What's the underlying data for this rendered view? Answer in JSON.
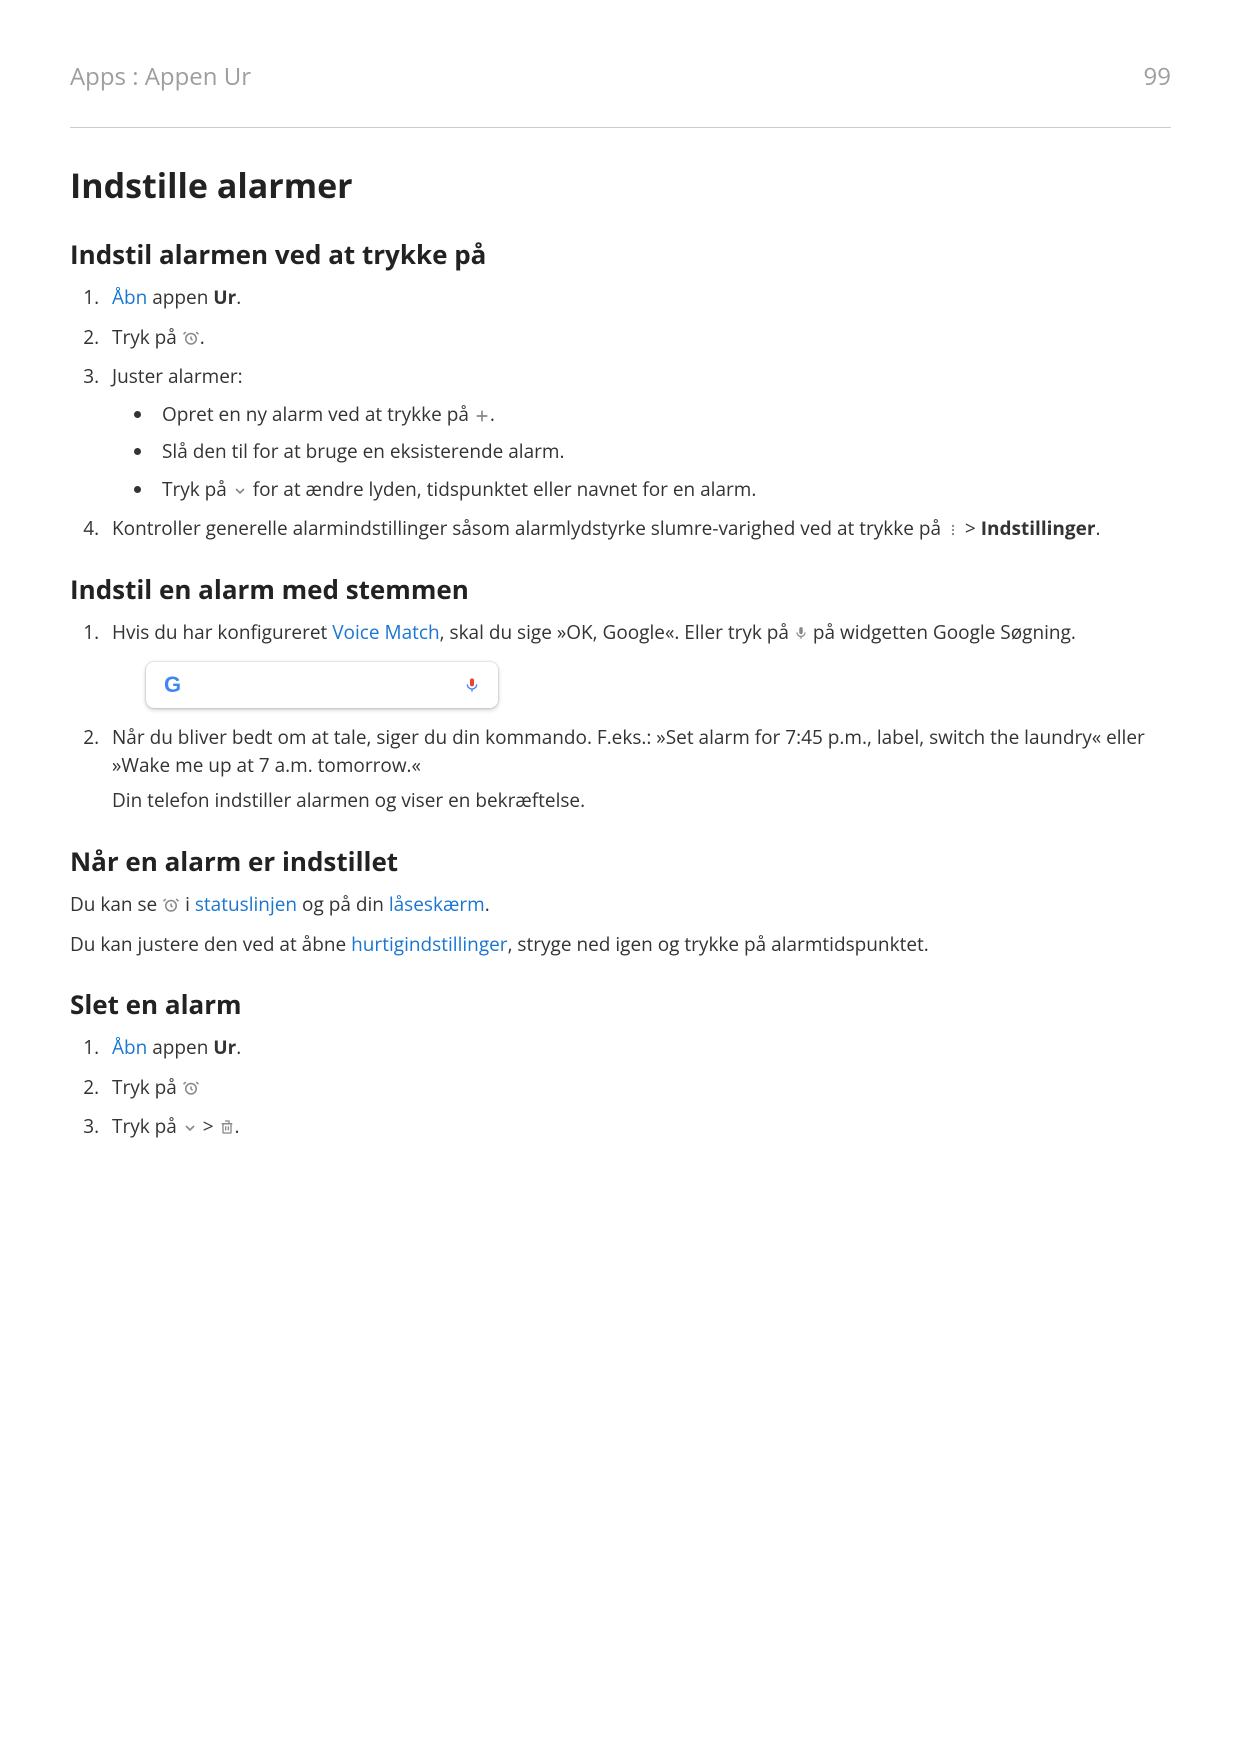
{
  "header": {
    "breadcrumb": "Apps : Appen Ur",
    "page_number": "99"
  },
  "h1": "Indstille alarmer",
  "s1": {
    "heading": "Indstil alarmen ved at trykke på",
    "li1_link": "Åbn",
    "li1_a": " appen ",
    "li1_b": "Ur",
    "li1_c": ".",
    "li2_a": "Tryk på ",
    "li2_b": ".",
    "li3": "Juster alarmer:",
    "sub1_a": "Opret en ny alarm ved at trykke på ",
    "sub1_b": ".",
    "sub2": "Slå den til for at bruge en eksisterende alarm.",
    "sub3_a": "Tryk på ",
    "sub3_b": " for at ændre lyden, tidspunktet eller navnet for en alarm.",
    "li4_a": "Kontroller generelle alarmindstillinger såsom alarmlydstyrke slumre-varighed ved at trykke på ",
    "li4_b": " > ",
    "li4_c": "Indstillinger",
    "li4_d": "."
  },
  "s2": {
    "heading": "Indstil en alarm med stemmen",
    "li1_a": "Hvis du har konfigureret ",
    "li1_link": "Voice Match",
    "li1_b": ", skal du sige »OK, Google«. Eller tryk på ",
    "li1_c": " på widgetten Google Søgning.",
    "li2": "Når du bliver bedt om at tale, siger du din kommando. F.eks.: »Set alarm for 7:45 p.m., label, switch the laundry« eller »Wake me up at 7 a.m. tomorrow.«",
    "li2_after": "Din telefon indstiller alarmen og viser en bekræftelse."
  },
  "s3": {
    "heading": "Når en alarm er indstillet",
    "p1_a": "Du kan se ",
    "p1_b": " i ",
    "p1_link1": "statuslinjen",
    "p1_c": " og på din ",
    "p1_link2": "låseskærm",
    "p1_d": ".",
    "p2_a": "Du kan justere den ved at åbne ",
    "p2_link": "hurtigindstillinger",
    "p2_b": ", stryge ned igen og trykke på alarmtidspunktet."
  },
  "s4": {
    "heading": "Slet en alarm",
    "li1_link": "Åbn",
    "li1_a": " appen ",
    "li1_b": "Ur",
    "li1_c": ".",
    "li2_a": "Tryk på ",
    "li3_a": "Tryk på ",
    "li3_b": " > ",
    "li3_c": "."
  }
}
